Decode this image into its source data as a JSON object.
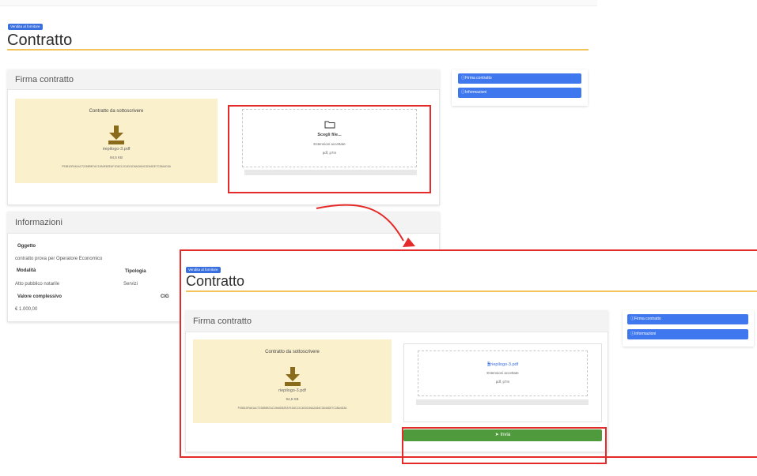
{
  "badge": "Vendita al fornitore",
  "page_title": "Contratto",
  "sidebar": {
    "items": [
      {
        "icon": "info-icon",
        "label": "Firma contratto"
      },
      {
        "icon": "info-icon",
        "label": "Informazioni"
      }
    ]
  },
  "firma": {
    "header": "Firma contratto",
    "download_title": "Contratto da sottoscrivere",
    "file_name": "riepilogo-3.pdf",
    "file_size": "94,5 KB",
    "hash": "F93B1DFA61AC7226B9B7AC19A0E82EAF1D6C12C4D01D6A2A54C3D46DE7C28A4D3A"
  },
  "upload_before": {
    "choose_label": "Scegli file...",
    "allowed_label": "Estensioni accettate",
    "extensions": "pdf, p7m"
  },
  "upload_after": {
    "selected_file": "riepilogo-3.pdf",
    "allowed_label": "Estensioni accettate",
    "extensions": "pdf, p7m",
    "send_label": "Invia"
  },
  "info": {
    "header": "Informazioni",
    "oggetto_label": "Oggetto",
    "oggetto_value": "contratto prova per Operatore Economico",
    "modalita_label": "Modalità",
    "modalita_value": "Atto pubblico notarile",
    "tipologia_label": "Tipologia",
    "tipologia_value": "Servizi",
    "valore_label": "Valore complessivo",
    "valore_value": "€ 1.000,00",
    "cig_label": "CIG"
  },
  "colors": {
    "accent_blue": "#3e77ee",
    "accent_yellow": "#f3c35a",
    "download_bg": "#fbf0cc",
    "send_green": "#4f9a3c",
    "annotation_red": "#e52a2a"
  }
}
